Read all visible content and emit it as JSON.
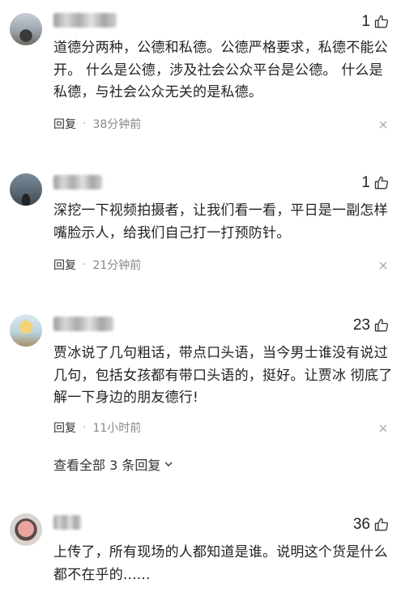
{
  "comments": [
    {
      "likes": "1",
      "text": "道德分两种，公德和私德。公德严格要求，私德不能公开。 什么是公德，涉及社会公众平台是公德。 什么是私德，与社会公众无关的是私德。",
      "reply_label": "回复",
      "time": "38分钟前"
    },
    {
      "likes": "1",
      "text": "深挖一下视频拍摄者，让我们看一看，平日是一副怎样嘴脸示人，给我们自己打一打预防针。",
      "reply_label": "回复",
      "time": "21分钟前"
    },
    {
      "likes": "23",
      "text": "贾冰说了几句粗话，带点口头语，当今男士谁没有说过几句，包括女孩都有带口头语的，挺好。让贾冰 彻底了解一下身边的朋友德行!",
      "reply_label": "回复",
      "time": "11小时前",
      "view_replies": "查看全部 3 条回复"
    },
    {
      "likes": "36",
      "text": "上传了，所有现场的人都知道是谁。说明这个货是什么都不在乎的......"
    }
  ],
  "icons": {
    "like": "thumbs-up-icon",
    "close": "close-icon",
    "expand": "chevron-down-icon"
  }
}
